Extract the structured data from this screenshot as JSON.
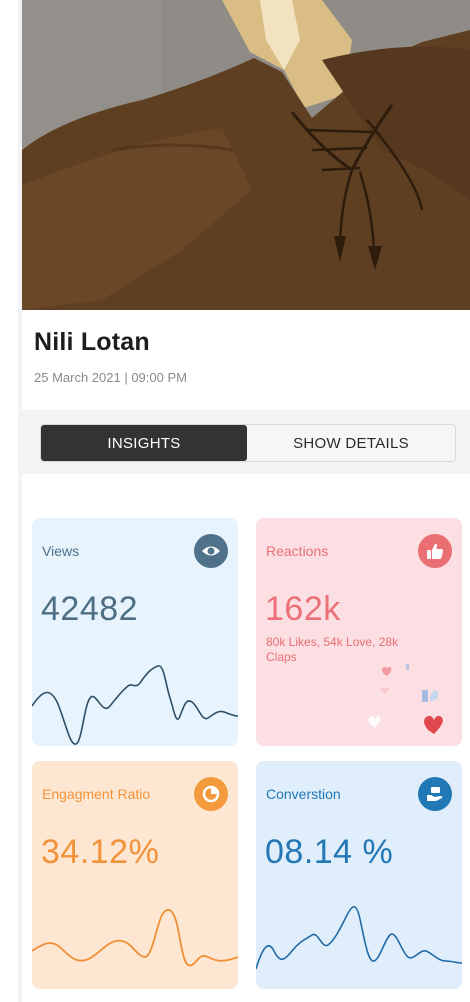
{
  "post": {
    "title": "Nili Lotan",
    "datetime": "25 March 2021 | 09:00 PM"
  },
  "tabs": [
    {
      "label": "INSIGHTS",
      "active": true
    },
    {
      "label": "SHOW DETAILS",
      "active": false
    }
  ],
  "cards": {
    "views": {
      "label": "Views",
      "value": "42482",
      "icon": "eye-icon",
      "color": "#4f7189"
    },
    "reactions": {
      "label": "Reactions",
      "value": "162k",
      "sub": "80k Likes, 54k Love, 28k Claps",
      "icon": "thumbs-up-icon",
      "color": "#ea6f73"
    },
    "engagement": {
      "label": "Engagment Ratio",
      "value": "34.12%",
      "icon": "pie-chart-icon",
      "color": "#f39a3d"
    },
    "conversion": {
      "label": "Converstion",
      "value": "08.14 %",
      "icon": "hand-money-icon",
      "color": "#2277b5"
    }
  }
}
